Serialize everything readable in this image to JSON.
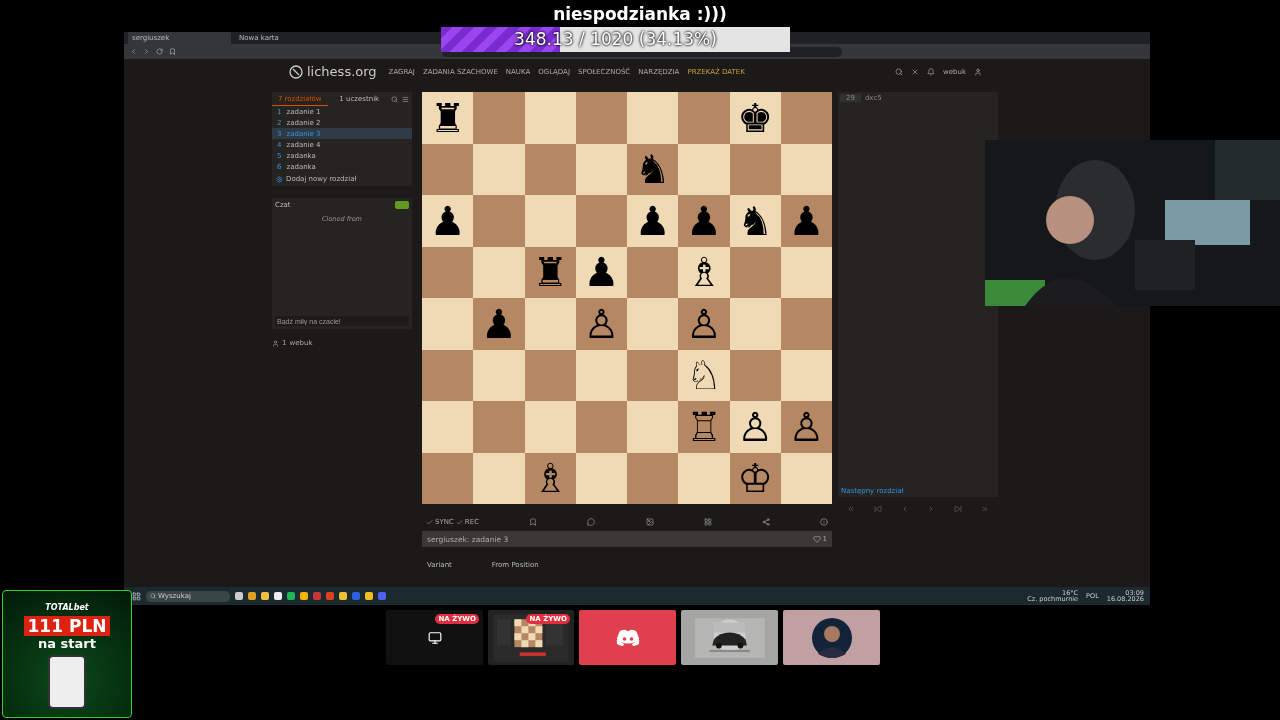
{
  "overlay": {
    "title": "niespodzianka :)))",
    "goal": {
      "reading": "348.13 / 1020 (34.13%)",
      "level": 0.3413
    }
  },
  "browser": {
    "tabs": [
      {
        "label": "sergiuszek",
        "selected": true
      },
      {
        "label": "Nowa karta",
        "selected": false
      }
    ]
  },
  "site": {
    "logo": "lichess.org",
    "nav": [
      "ZAGRAJ",
      "ZADANIA SZACHOWE",
      "NAUKA",
      "OGLĄDAJ",
      "SPOŁECZNOŚĆ",
      "NARZĘDZIA",
      "PRZEKAŻ DATEK"
    ],
    "user": "webuk"
  },
  "study": {
    "tabs": [
      {
        "label": "7 rozdziałów",
        "selected": true
      },
      {
        "label": "1 uczestnik",
        "selected": false
      }
    ],
    "chapters": [
      {
        "number": "1",
        "name": "zadanie 1",
        "selected": false
      },
      {
        "number": "2",
        "name": "zadanie 2",
        "selected": false
      },
      {
        "number": "3",
        "name": "zadanie 3",
        "selected": true
      },
      {
        "number": "4",
        "name": "zadanie 4",
        "selected": false
      },
      {
        "number": "5",
        "name": "zadanka",
        "selected": false
      },
      {
        "number": "6",
        "name": "zadanka",
        "selected": false
      }
    ],
    "add_chapter": "Dodaj nowy rozdział",
    "chat": {
      "title": "Czat",
      "on": true,
      "note": "Cloned from",
      "placeholder": "Bądź miły na czacie!"
    },
    "online": {
      "count": "1",
      "user": "webuk"
    }
  },
  "board": {
    "ranks": [
      [
        {
          "kind": "piece",
          "glyph": "♜"
        },
        {
          "kind": "empty"
        },
        {
          "kind": "empty"
        },
        {
          "kind": "empty"
        },
        {
          "kind": "empty"
        },
        {
          "kind": "empty"
        },
        {
          "kind": "piece",
          "glyph": "♚"
        },
        {
          "kind": "empty"
        }
      ],
      [
        {
          "kind": "empty"
        },
        {
          "kind": "empty"
        },
        {
          "kind": "empty"
        },
        {
          "kind": "empty"
        },
        {
          "kind": "piece",
          "glyph": "♞"
        },
        {
          "kind": "empty"
        },
        {
          "kind": "empty"
        },
        {
          "kind": "empty"
        }
      ],
      [
        {
          "kind": "piece",
          "glyph": "♟"
        },
        {
          "kind": "empty"
        },
        {
          "kind": "empty"
        },
        {
          "kind": "empty"
        },
        {
          "kind": "piece",
          "glyph": "♟"
        },
        {
          "kind": "piece",
          "glyph": "♟"
        },
        {
          "kind": "piece",
          "glyph": "♞"
        },
        {
          "kind": "piece",
          "glyph": "♟"
        }
      ],
      [
        {
          "kind": "empty"
        },
        {
          "kind": "empty"
        },
        {
          "kind": "piece",
          "glyph": "♜"
        },
        {
          "kind": "piece",
          "glyph": "♟"
        },
        {
          "kind": "empty"
        },
        {
          "kind": "piece",
          "glyph": "♗"
        },
        {
          "kind": "empty"
        },
        {
          "kind": "empty"
        }
      ],
      [
        {
          "kind": "empty"
        },
        {
          "kind": "piece",
          "glyph": "♟"
        },
        {
          "kind": "empty"
        },
        {
          "kind": "piece",
          "glyph": "♙"
        },
        {
          "kind": "empty"
        },
        {
          "kind": "piece",
          "glyph": "♙"
        },
        {
          "kind": "empty"
        },
        {
          "kind": "empty"
        }
      ],
      [
        {
          "kind": "empty"
        },
        {
          "kind": "empty"
        },
        {
          "kind": "empty"
        },
        {
          "kind": "empty"
        },
        {
          "kind": "empty"
        },
        {
          "kind": "piece",
          "glyph": "♘"
        },
        {
          "kind": "empty"
        },
        {
          "kind": "empty"
        }
      ],
      [
        {
          "kind": "empty"
        },
        {
          "kind": "empty"
        },
        {
          "kind": "empty"
        },
        {
          "kind": "empty"
        },
        {
          "kind": "empty"
        },
        {
          "kind": "piece",
          "glyph": "♖"
        },
        {
          "kind": "piece",
          "glyph": "♙"
        },
        {
          "kind": "piece",
          "glyph": "♙"
        }
      ],
      [
        {
          "kind": "empty"
        },
        {
          "kind": "empty"
        },
        {
          "kind": "piece",
          "glyph": "♗"
        },
        {
          "kind": "empty"
        },
        {
          "kind": "empty"
        },
        {
          "kind": "empty"
        },
        {
          "kind": "piece",
          "glyph": "♔"
        },
        {
          "kind": "empty"
        }
      ]
    ]
  },
  "tools": {
    "sync": "SYNC",
    "rec": "REC"
  },
  "chapter": {
    "title": "sergiuszek: zadanie 3",
    "likes": "1",
    "fields": [
      {
        "label": "Variant",
        "value": "From Position"
      }
    ]
  },
  "moves": {
    "number": "29",
    "move": "dxc5",
    "next": "Następny rozdział"
  },
  "taskbar": {
    "search": "Wyszukaj",
    "temp": "16°C",
    "weather": "Cz. pochmurnie",
    "lang": "POL",
    "time": "03:09",
    "date": "16.08.2026"
  },
  "ad": {
    "brand": "TOTALbet",
    "amount": "111 PLN",
    "tagline": "na start"
  },
  "tiles": [
    {
      "kind": "screen",
      "badge": "NA ŻYWO"
    },
    {
      "kind": "game",
      "badge": "NA ŻYWO"
    },
    {
      "kind": "discord"
    },
    {
      "kind": "car"
    },
    {
      "kind": "avatar"
    }
  ]
}
